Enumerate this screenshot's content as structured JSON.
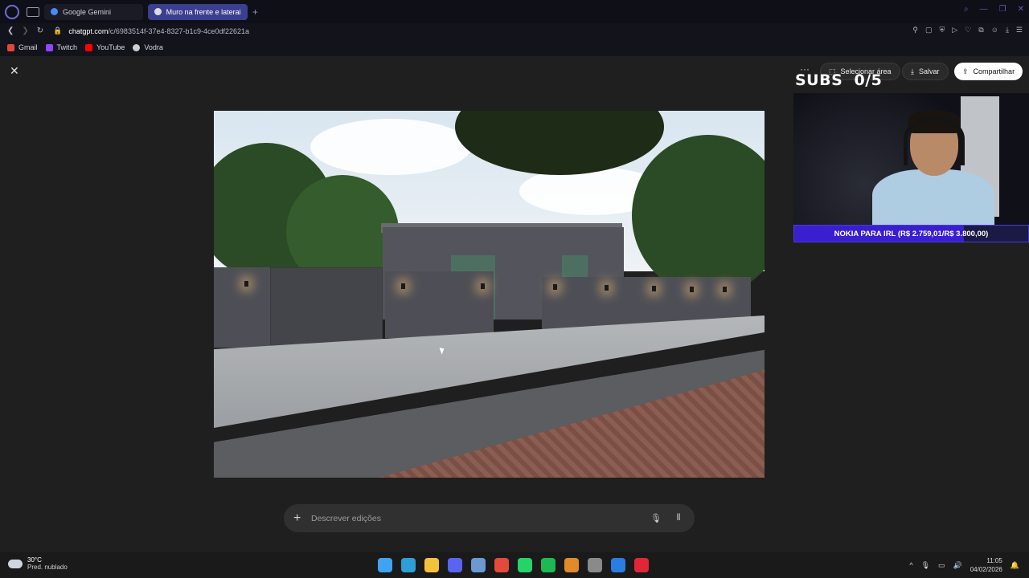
{
  "browser": {
    "tabs": [
      {
        "title": "Google Gemini",
        "active": false,
        "favicon_color": "#4a8cf0"
      },
      {
        "title": "Muro na frente e laterais",
        "active": true,
        "favicon_color": "#dcdcdc"
      }
    ],
    "url": {
      "host": "chatgpt.com",
      "path": "/c/6983514f-37e4-8327-b1c9-4ce0df22621a"
    },
    "bookmarks": [
      {
        "label": "Gmail",
        "icon": "gmail-icon",
        "color": "#e4473a"
      },
      {
        "label": "Twitch",
        "icon": "twitch-icon",
        "color": "#9146ff"
      },
      {
        "label": "YouTube",
        "icon": "youtube-icon",
        "color": "#ff0000"
      },
      {
        "label": "Vodra",
        "icon": "vodra-icon",
        "color": "#cfcfcf"
      }
    ]
  },
  "viewer": {
    "select_area_label": "Selecionar área",
    "save_label": "Salvar",
    "share_label": "Compartilhar",
    "prompt_placeholder": "Descrever edições"
  },
  "overlay": {
    "subs_label": "SUBS",
    "subs_count": "0/5",
    "goal_text": "NOKIA PARA IRL (R$ 2.759,01/R$ 3.800,00)",
    "goal_progress": 0.726
  },
  "taskbar": {
    "temperature": "30°C",
    "weather_text": "Pred. nublado",
    "time": "11:05",
    "date": "04/02/2026",
    "apps": [
      {
        "name": "windows-start-icon",
        "color": "#3ea3f0"
      },
      {
        "name": "edge-icon",
        "color": "#2e9fd6"
      },
      {
        "name": "file-explorer-icon",
        "color": "#f3c23d"
      },
      {
        "name": "discord-icon",
        "color": "#5865f2"
      },
      {
        "name": "steam-icon",
        "color": "#6a9ad0"
      },
      {
        "name": "chrome-icon",
        "color": "#e44a3b"
      },
      {
        "name": "whatsapp-icon",
        "color": "#25d366"
      },
      {
        "name": "spotify-icon",
        "color": "#1db954"
      },
      {
        "name": "app-orange-icon",
        "color": "#e08a2a"
      },
      {
        "name": "app-gray-icon",
        "color": "#8a8a8a"
      },
      {
        "name": "app-blue-icon",
        "color": "#2a7de1"
      },
      {
        "name": "opera-gx-icon",
        "color": "#e2263a"
      }
    ]
  }
}
